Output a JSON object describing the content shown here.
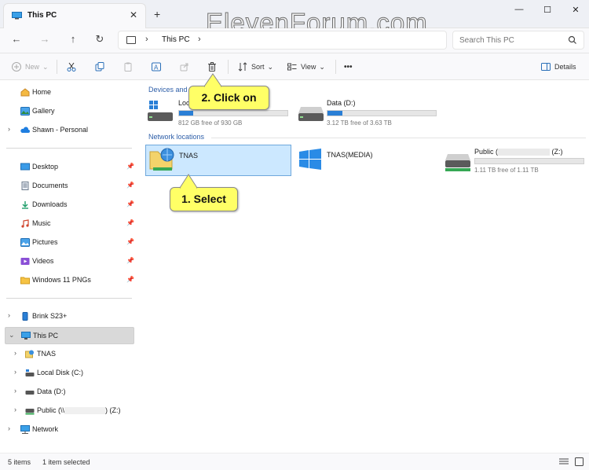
{
  "window": {
    "tab_title": "This PC",
    "close_tab": "✕",
    "new_tab": "+",
    "minimize": "—",
    "maximize": "☐",
    "close": "✕"
  },
  "brand_watermark": "ElevenForum.com",
  "address": {
    "crumb": "This PC",
    "sep": "›",
    "search_placeholder": "Search This PC"
  },
  "toolbar": {
    "new_label": "New",
    "sort_label": "Sort",
    "view_label": "View",
    "more_label": "•••",
    "details_label": "Details"
  },
  "sidebar": {
    "home": "Home",
    "gallery": "Gallery",
    "onedrive": "Shawn - Personal",
    "desktop": "Desktop",
    "documents": "Documents",
    "downloads": "Downloads",
    "music": "Music",
    "pictures": "Pictures",
    "videos": "Videos",
    "win11pngs": "Windows 11 PNGs",
    "phone": "Brink S23+",
    "thispc": "This PC",
    "tnas": "TNAS",
    "local_c": "Local Disk (C:)",
    "data_d": "Data (D:)",
    "public_z_prefix": "Public (\\\\",
    "public_z_suffix": ") (Z:)",
    "network": "Network"
  },
  "content": {
    "devices_header": "Devices and d",
    "network_header": "Network locations",
    "local_disk": {
      "name": "Loc",
      "free": "812 GB free of 930 GB",
      "used_fraction": 0.13
    },
    "data_d": {
      "name": "Data (D:)",
      "free": "3.12 TB free of 3.63 TB",
      "used_fraction": 0.14
    },
    "tnas": {
      "name": "TNAS"
    },
    "tnas_media": {
      "name": "TNAS(MEDIA)"
    },
    "public_z": {
      "name_prefix": "Public (",
      "name_suffix": " (Z:)",
      "free": "1.11 TB free of 1.11 TB",
      "used_fraction": 0.0
    }
  },
  "callouts": {
    "click_on": "2. Click on",
    "select": "1. Select"
  },
  "status": {
    "items": "5 items",
    "selected": "1 item selected"
  },
  "colors": {
    "accent": "#2a7fd6",
    "selection": "#cce8ff",
    "callout": "#ffff66",
    "group_header": "#2d5ea8"
  }
}
